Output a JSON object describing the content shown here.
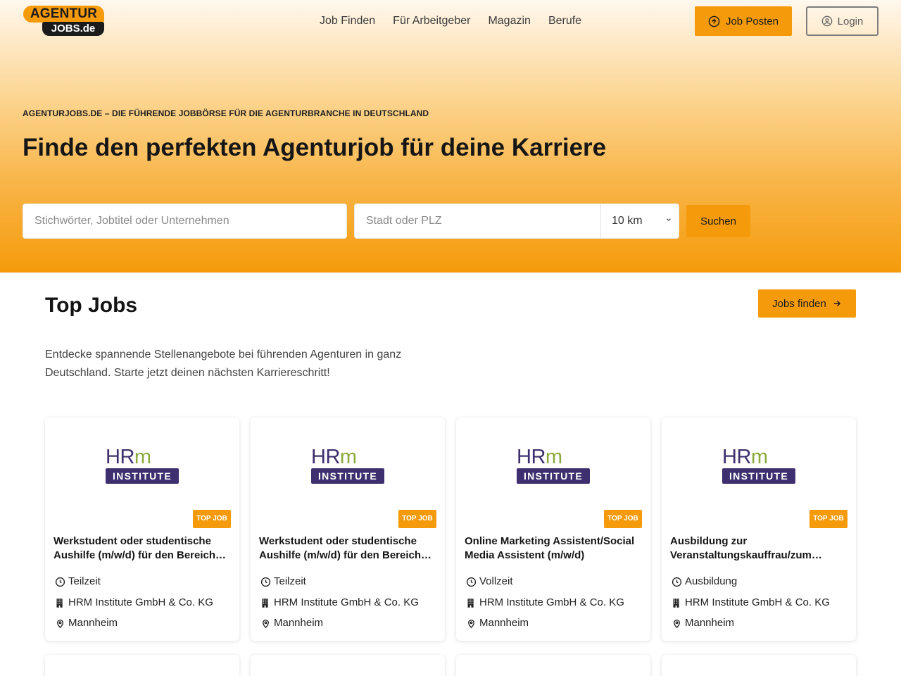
{
  "brand": {
    "logo_top": "AGENTUR",
    "logo_bottom": "JOBS.de",
    "accent": "#f59b0b"
  },
  "nav": [
    "Job Finden",
    "Für Arbeitgeber",
    "Magazin",
    "Berufe"
  ],
  "header": {
    "post_label": "Job Posten",
    "login_label": "Login"
  },
  "hero": {
    "eyebrow": "AGENTURJOBS.DE – DIE FÜHRENDE JOBBÖRSE FÜR DIE AGENTURBRANCHE IN DEUTSCHLAND",
    "headline": "Finde den perfekten Agenturjob für deine Karriere"
  },
  "search": {
    "keywords_placeholder": "Stichwörter, Jobtitel oder Unternehmen",
    "city_placeholder": "Stadt oder PLZ",
    "radius": "10 km",
    "submit_label": "Suchen"
  },
  "top_jobs": {
    "title": "Top Jobs",
    "button_label": "Jobs finden",
    "intro": "Entdecke spannende Stellenangebote bei führenden Agenturen in ganz Deutschland. Starte jetzt deinen nächsten Karriereschritt!",
    "jobs": [
      {
        "logo_hr": "HR",
        "logo_m": "m",
        "logo_sub": "INSTITUTE",
        "badge": "TOP JOB",
        "title": "Werkstudent oder studentische Aushilfe (m/w/d) für den Bereich Marketing",
        "type": "Teilzeit",
        "company": "HRM Institute GmbH & Co. KG",
        "location": "Mannheim"
      },
      {
        "logo_hr": "HR",
        "logo_m": "m",
        "logo_sub": "INSTITUTE",
        "badge": "TOP JOB",
        "title": "Werkstudent oder studentische Aushilfe (m/w/d) für den Bereich Eventmanagement",
        "type": "Teilzeit",
        "company": "HRM Institute GmbH & Co. KG",
        "location": "Mannheim"
      },
      {
        "logo_hr": "HR",
        "logo_m": "m",
        "logo_sub": "INSTITUTE",
        "badge": "TOP JOB",
        "title": "Online Marketing Assistent/Social Media Assistent (m/w/d)",
        "type": "Vollzeit",
        "company": "HRM Institute GmbH & Co. KG",
        "location": "Mannheim"
      },
      {
        "logo_hr": "HR",
        "logo_m": "m",
        "logo_sub": "INSTITUTE",
        "badge": "TOP JOB",
        "title": "Ausbildung zur Veranstaltungskauffrau/zum Veranstaltungskaufmann (m/w/d)",
        "type": "Ausbildung",
        "company": "HRM Institute GmbH & Co. KG",
        "location": "Mannheim"
      }
    ]
  }
}
